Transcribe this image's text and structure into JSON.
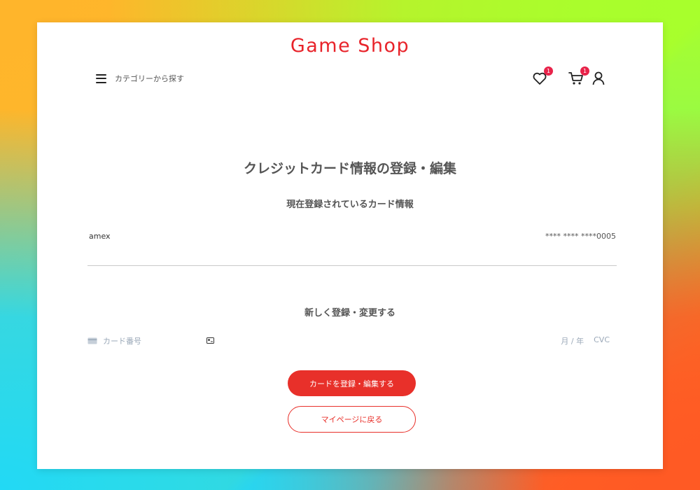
{
  "site": {
    "brand": "Game Shop"
  },
  "header": {
    "category_label": "カテゴリーから探す",
    "wishlist_badge": "1",
    "cart_badge": "1"
  },
  "main": {
    "title": "クレジットカード情報の登録・編集",
    "current_section_title": "現在登録されているカード情報",
    "current_card": {
      "brand": "amex",
      "masked_number": "**** **** ****0005"
    },
    "new_section_title": "新しく登録・変更する",
    "card_input": {
      "number_placeholder": "カード番号",
      "expiry_placeholder": "月 / 年",
      "cvc_placeholder": "CVC"
    },
    "submit_label": "カードを登録・編集する",
    "back_label": "マイページに戻る"
  },
  "colors": {
    "accent": "#e8302a",
    "badge": "#e8234a",
    "brand": "#e8232a"
  },
  "icons": [
    "menu-icon",
    "heart-icon",
    "cart-icon",
    "user-icon",
    "credit-card-icon",
    "card-brand-icon"
  ]
}
